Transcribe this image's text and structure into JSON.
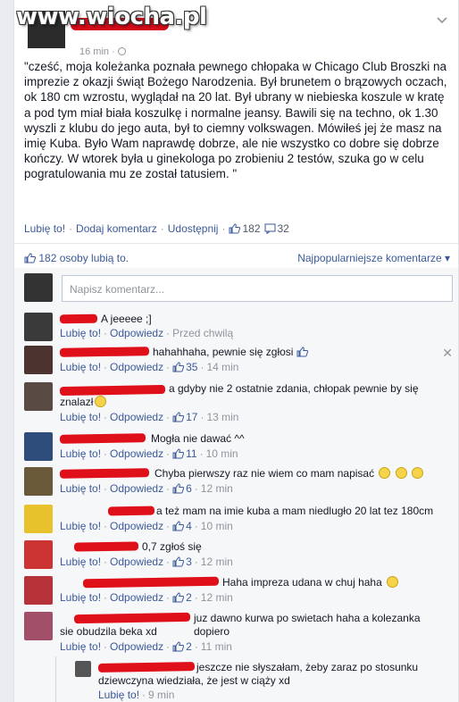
{
  "watermark": "www.wiocha.pl",
  "post": {
    "time": "16 min",
    "text": "\"cześć, moja koleżanka poznała pewnego chłopaka w Chicago Club Broszki na imprezie z okazji świąt Bożego Narodzenia. Był brunetem o brązowych oczach, ok 180 cm wzrostu, wyglądał na 20 lat. Był ubrany w niebieska koszule w kratę a pod tym miał biała koszulkę i normalne jeansy. Bawili się na techno, ok 1.30 wyszli z klubu do jego auta, był to ciemny volkswagen. Mówiłeś jej że masz na imię Kuba. Było Wam naprawdę dobrze, ale nie wszystko co dobre się dobrze kończy. W wtorek była u ginekologa po zrobieniu 2 testów, szuka go w celu pogratulowania mu ze został tatusiem. \"",
    "actions": {
      "like": "Lubię to!",
      "comment": "Dodaj komentarz",
      "share": "Udostępnij",
      "sep": "·"
    },
    "like_count": "182",
    "comment_count": "32"
  },
  "likes_row": {
    "summary": "182 osoby lubią to.",
    "sort": "Najpopularniejsze komentarze ▾"
  },
  "composer": {
    "placeholder": "Napisz komentarz..."
  },
  "comments": [
    {
      "text": "A jeeeee ;]",
      "like": "Lubię to!",
      "reply": "Odpowiedz",
      "likes": "",
      "time": "Przed chwilą"
    },
    {
      "text": "hahahhaha, pewnie się zgłosi",
      "like": "Lubię to!",
      "reply": "Odpowiedz",
      "likes": "35",
      "time": "14 min"
    },
    {
      "text": "a gdyby nie 2 ostatnie zdania, chłopak pewnie by się",
      "text2": "znalazł",
      "like": "Lubię to!",
      "reply": "Odpowiedz",
      "likes": "17",
      "time": "13 min"
    },
    {
      "text": "Mogła nie dawać ^^",
      "like": "Lubię to!",
      "reply": "Odpowiedz",
      "likes": "11",
      "time": "10 min"
    },
    {
      "text": "Chyba pierwszy raz nie wiem co mam napisać",
      "like": "Lubię to!",
      "reply": "Odpowiedz",
      "likes": "6",
      "time": "12 min"
    },
    {
      "text": "a też mam na imie kuba a mam niedlugło 20 lat tez 180cm",
      "like": "Lubię to!",
      "reply": "Odpowiedz",
      "likes": "4",
      "time": "10 min"
    },
    {
      "text": "0,7 zgłoś się",
      "like": "Lubię to!",
      "reply": "Odpowiedz",
      "likes": "3",
      "time": "12 min"
    },
    {
      "text": "Haha impreza udana w chuj haha",
      "like": "Lubię to!",
      "reply": "Odpowiedz",
      "likes": "2",
      "time": "12 min"
    },
    {
      "text": "juz dawno kurwa po swietach haha a kolezanka dopiero",
      "text2": "sie obudzila beka xd",
      "like": "Lubię to!",
      "reply": "Odpowiedz",
      "likes": "2",
      "time": "11 min"
    },
    {
      "text": "jeszcze nie słyszałam, żeby zaraz po stosunku",
      "text2": "dziewczyna wiedziała, że jest w ciąży xd",
      "like": "Lubię to!",
      "reply": "",
      "likes": "",
      "time": "9 min"
    }
  ],
  "colors": {
    "link": "#3b5998",
    "redaction": "#e0101a",
    "muted": "#90949c"
  }
}
